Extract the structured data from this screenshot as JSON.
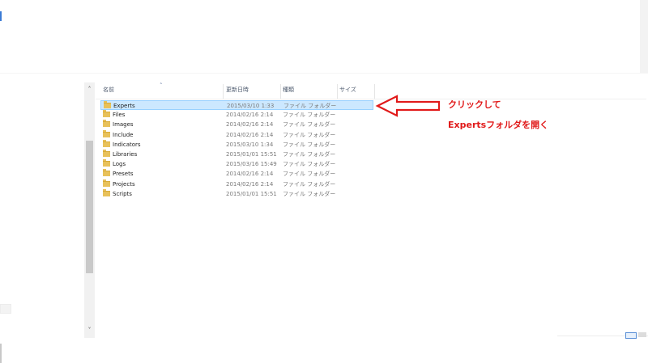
{
  "columns": {
    "name": "名前",
    "date": "更新日時",
    "type": "種類",
    "size": "サイズ"
  },
  "scroll": {
    "up": "˄",
    "down": "˅"
  },
  "sort_indicator": "˄",
  "files": [
    {
      "name": "Experts",
      "date": "2015/03/10 1:33",
      "type": "ファイル フォルダー",
      "selected": true
    },
    {
      "name": "Files",
      "date": "2014/02/16 2:14",
      "type": "ファイル フォルダー"
    },
    {
      "name": "Images",
      "date": "2014/02/16 2:14",
      "type": "ファイル フォルダー"
    },
    {
      "name": "Include",
      "date": "2014/02/16 2:14",
      "type": "ファイル フォルダー"
    },
    {
      "name": "Indicators",
      "date": "2015/03/10 1:34",
      "type": "ファイル フォルダー"
    },
    {
      "name": "Libraries",
      "date": "2015/01/01 15:51",
      "type": "ファイル フォルダー"
    },
    {
      "name": "Logs",
      "date": "2015/03/16 15:49",
      "type": "ファイル フォルダー"
    },
    {
      "name": "Presets",
      "date": "2014/02/16 2:14",
      "type": "ファイル フォルダー"
    },
    {
      "name": "Projects",
      "date": "2014/02/16 2:14",
      "type": "ファイル フォルダー"
    },
    {
      "name": "Scripts",
      "date": "2015/01/01 15:51",
      "type": "ファイル フォルダー"
    }
  ],
  "annotation": {
    "line1": "クリックして",
    "line2": "Expertsフォルダを開く",
    "color": "#e11a1a"
  },
  "icons": {
    "folder": "folder-icon",
    "arrow": "left-arrow-icon"
  }
}
